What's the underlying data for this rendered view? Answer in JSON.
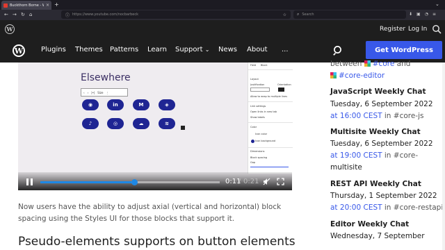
{
  "browser": {
    "tab_title": "Buckthorn Borne - WordPress",
    "tab_close": "×",
    "new_tab": "+",
    "tab_menu": "⌄",
    "nav_icons": [
      "←",
      "→",
      "↻",
      "⌂"
    ],
    "url_icon": "ⓘ",
    "url": "https://www.youtube.com/nocbarbeck",
    "star": "☆",
    "search_placeholder": "Search",
    "toolbar_icons": [
      "⬇",
      "▣",
      "◔",
      "≡"
    ]
  },
  "wp_topbar": {
    "register": "Register",
    "login": "Log In"
  },
  "nav": {
    "plugins": "Plugins",
    "themes": "Themes",
    "patterns": "Patterns",
    "learn": "Learn",
    "support": "Support",
    "support_caret": "⌄",
    "news": "News",
    "about": "About",
    "more": "...",
    "get_wp": "Get WordPress"
  },
  "video": {
    "heading": "Elsewhere",
    "mini_toolbar": [
      "‹",
      "›",
      "|•|",
      "Size",
      "⋮"
    ],
    "icons_row1": [
      "◉",
      "in",
      "M",
      "◈"
    ],
    "icons_row2": [
      "♪",
      "◎",
      "☁",
      "≋"
    ],
    "panel": [
      "Field",
      "Block",
      "Layout",
      "Justification",
      "Orientation",
      "Allow to wrap to multiple lines",
      "Link settings",
      "Open links in new tab",
      "Show labels",
      "Color",
      "Icon color",
      "Icon background",
      "Dimensions",
      "Block spacing",
      "Gap"
    ],
    "time_current": "0:11",
    "time_sep": "/",
    "time_total": "0:21",
    "progress_fraction": 0.52
  },
  "article": {
    "paragraph": "Now users have the ability to adjust axial (vertical and horizontal) block spacing using the Styles UI for those blocks that support it.",
    "heading": "Pseudo-elements supports on button elements"
  },
  "sidebar": {
    "line0_pre": "between ",
    "line0_chan": "#core",
    "line0_and": " and",
    "line1_chan": "#core-editor",
    "meetings": [
      {
        "title": "JavaScript Weekly Chat",
        "when1": "Tuesday, 6 September 2022",
        "when2": "at 16:00 CEST",
        "in_text": " in #core-js"
      },
      {
        "title": "Multisite Weekly Chat",
        "when1": "Tuesday, 6 September 2022",
        "when2": "at 19:00 CEST",
        "in_text": " in #core-",
        "in_text2": "multisite"
      },
      {
        "title": "REST API Weekly Chat",
        "when1": "Thursday, 1 September 2022",
        "when2": "at 20:00 CEST",
        "in_text": " in #core-restapi"
      },
      {
        "title": "Editor Weekly Chat",
        "when1": "Wednesday, 7 September"
      }
    ]
  }
}
